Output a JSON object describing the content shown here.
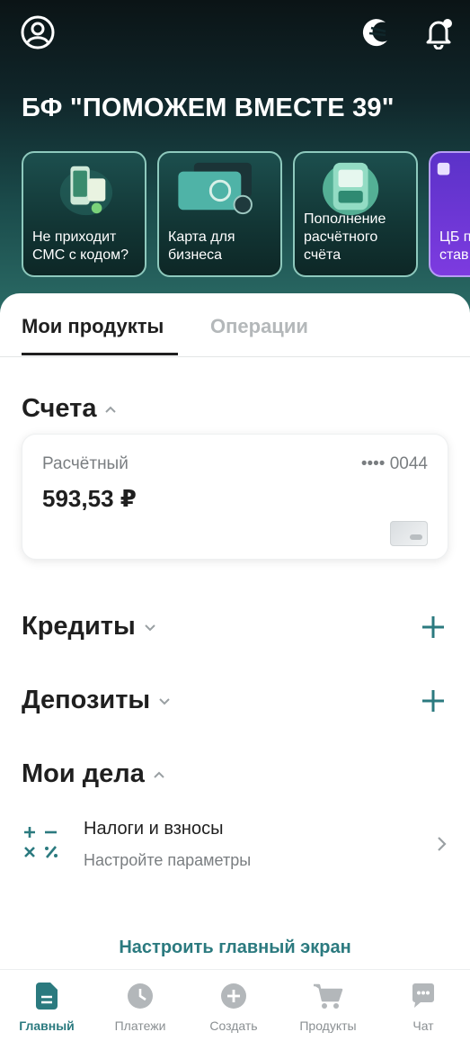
{
  "header": {
    "company_name": "БФ \"ПОМОЖЕМ ВМЕСТЕ 39\"",
    "icons": [
      "profile-icon",
      "logo-moon-icon",
      "notifications-bell-icon"
    ]
  },
  "stories": [
    {
      "label": "Не приходит СМС с кодом?"
    },
    {
      "label": "Карта для бизнеса"
    },
    {
      "label": "Пополнение расчётного счёта"
    },
    {
      "label": "ЦБ п… клю… став…"
    }
  ],
  "tabs": [
    {
      "label": "Мои продукты",
      "active": true
    },
    {
      "label": "Операции",
      "active": false
    }
  ],
  "sections": {
    "accounts": {
      "title": "Счета",
      "expanded": true
    },
    "credits": {
      "title": "Кредиты",
      "expanded": false
    },
    "deposits": {
      "title": "Депозиты",
      "expanded": false
    },
    "tasks": {
      "title": "Мои дела",
      "expanded": true
    }
  },
  "account": {
    "type": "Расчётный",
    "number_mask": "•••• 0044",
    "balance": "593,53 ₽"
  },
  "task": {
    "title": "Налоги и взносы",
    "subtitle": "Настройте параметры",
    "icon": "tax-calculator-icon"
  },
  "customize_link": "Настроить главный экран",
  "bottom_nav": [
    {
      "label": "Главный",
      "icon": "home-document-icon",
      "active": true
    },
    {
      "label": "Платежи",
      "icon": "clock-icon",
      "active": false
    },
    {
      "label": "Создать",
      "icon": "plus-circle-icon",
      "active": false
    },
    {
      "label": "Продукты",
      "icon": "cart-icon",
      "active": false
    },
    {
      "label": "Чат",
      "icon": "chat-icon",
      "active": false
    }
  ],
  "colors": {
    "accent": "#2b7a7f",
    "hero_dark": "#0b1416",
    "hero_teal": "#2c6e68",
    "text_primary": "#1f1f1f",
    "text_secondary": "#7a7e81"
  }
}
